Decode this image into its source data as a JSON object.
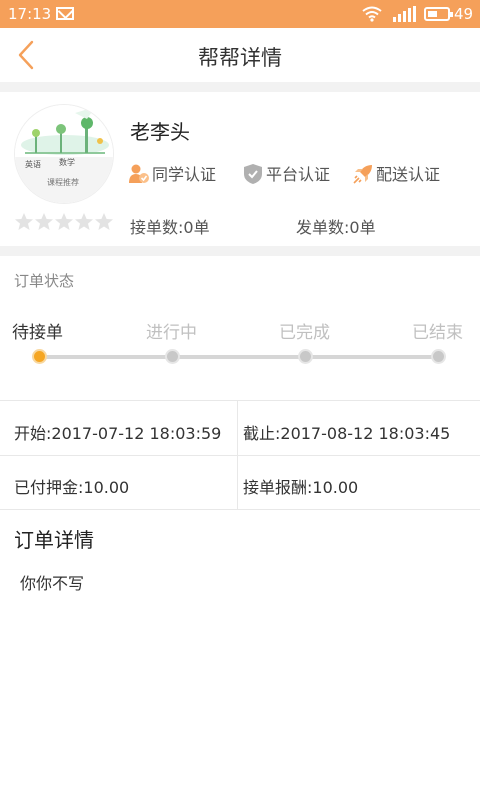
{
  "status_bar": {
    "time": "17:13",
    "battery": "49",
    "battery_level": 0.49,
    "background": "#f5a05a"
  },
  "nav": {
    "title": "帮帮详情",
    "back_icon": "chevron-left-icon",
    "accent": "#f5a05a"
  },
  "profile": {
    "name": "老李头",
    "avatar_texts": [
      "英语",
      "数学",
      "课程推荐"
    ],
    "rating": 0,
    "rating_max": 5,
    "certifications": [
      {
        "label": "同学认证",
        "icon": "student-badge-icon",
        "color": "#f5a05a"
      },
      {
        "label": "平台认证",
        "icon": "shield-check-icon",
        "color": "#b0b0b0"
      },
      {
        "label": "配送认证",
        "icon": "rocket-icon",
        "color": "#f5a05a"
      }
    ],
    "accepted_count": "接单数:0单",
    "posted_count": "发单数:0单"
  },
  "order_status": {
    "section_title": "订单状态",
    "steps": [
      "待接单",
      "进行中",
      "已完成",
      "已结束"
    ],
    "current_step": 0,
    "active_color": "#f5a623"
  },
  "info": {
    "start": "开始:2017-07-12 18:03:59",
    "deadline": "截止:2017-08-12 18:03:45",
    "deposit": "已付押金:10.00",
    "reward": "接单报酬:10.00"
  },
  "detail": {
    "title": "订单详情",
    "text": "你你不写"
  }
}
